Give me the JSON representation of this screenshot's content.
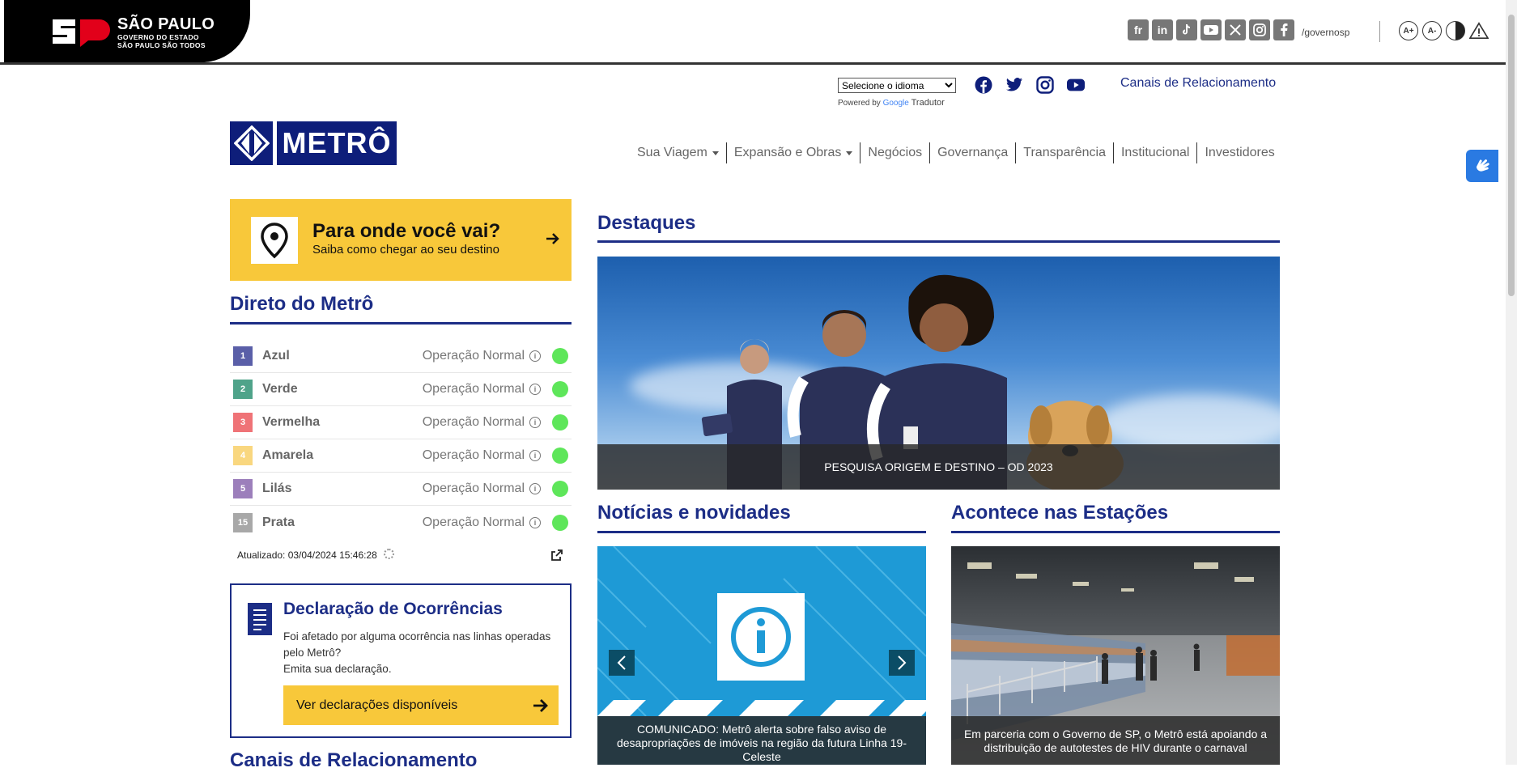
{
  "gov_bar": {
    "title": "SÃO PAULO",
    "line2": "GOVERNO DO ESTADO",
    "line3": "SÃO PAULO SÃO TODOS",
    "social_icons": [
      "flickr-icon",
      "linkedin-icon",
      "tiktok-icon",
      "youtube-icon",
      "x-icon",
      "instagram-icon",
      "facebook-icon"
    ],
    "flickr_label": "fr",
    "linkedin_label": "in",
    "handle": "/governosp",
    "font_increase": "A+",
    "font_decrease": "A-"
  },
  "utility": {
    "language_select": "Selecione o idioma",
    "powered_by": "Powered by",
    "google": "Google",
    "translator": "Tradutor",
    "canais_link": "Canais de Relacionamento"
  },
  "brand": {
    "name": "METRÔ",
    "color": "#0e1e7a"
  },
  "nav": {
    "items": [
      {
        "label": "Sua Viagem",
        "dropdown": true
      },
      {
        "label": "Expansão e Obras",
        "dropdown": true
      },
      {
        "label": "Negócios",
        "dropdown": false
      },
      {
        "label": "Governança",
        "dropdown": false
      },
      {
        "label": "Transparência",
        "dropdown": false
      },
      {
        "label": "Institucional",
        "dropdown": false
      },
      {
        "label": "Investidores",
        "dropdown": false
      }
    ]
  },
  "where": {
    "title": "Para onde você vai?",
    "subtitle": "Saiba como chegar ao seu destino"
  },
  "direto": {
    "title": "Direto do Metrô",
    "lines": [
      {
        "num": "1",
        "name": "Azul",
        "status": "Operação Normal",
        "color": "#5a5fa8"
      },
      {
        "num": "2",
        "name": "Verde",
        "status": "Operação Normal",
        "color": "#4fa38a"
      },
      {
        "num": "3",
        "name": "Vermelha",
        "status": "Operação Normal",
        "color": "#ef7377"
      },
      {
        "num": "4",
        "name": "Amarela",
        "status": "Operação Normal",
        "color": "#f9d77f"
      },
      {
        "num": "5",
        "name": "Lilás",
        "status": "Operação Normal",
        "color": "#9c7fbb"
      },
      {
        "num": "15",
        "name": "Prata",
        "status": "Operação Normal",
        "color": "#a8a8a8"
      }
    ],
    "updated": "Atualizado: 03/04/2024 15:46:28",
    "status_color": "#5ee65a"
  },
  "declaracao": {
    "title": "Declaração de Ocorrências",
    "text1": "Foi afetado por alguma ocorrência nas linhas operadas pelo Metrô?",
    "text2": "Emita sua declaração.",
    "button": "Ver declarações disponíveis"
  },
  "canais_heading": "Canais de Relacionamento",
  "destaques": {
    "title": "Destaques",
    "caption": "PESQUISA ORIGEM E DESTINO – OD 2023"
  },
  "noticias": {
    "title": "Notícias e novidades",
    "caption": "COMUNICADO: Metrô alerta sobre falso aviso de desapropriações de imóveis na região da futura Linha 19-Celeste"
  },
  "acontece": {
    "title": "Acontece nas Estações",
    "caption": "Em parceria com o Governo de SP, o Metrô está apoiando a distribuição de autotestes de HIV durante o carnaval"
  }
}
